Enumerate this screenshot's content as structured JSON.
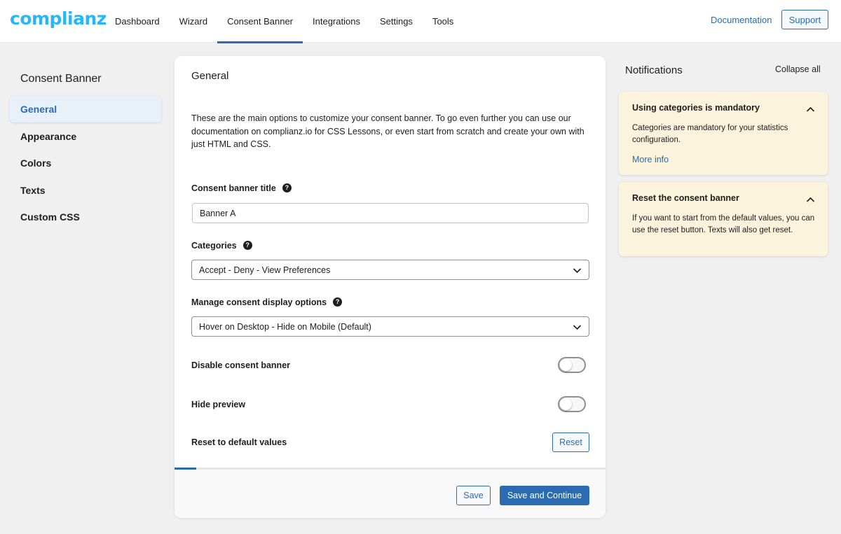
{
  "header": {
    "logo": "complianz",
    "nav": [
      {
        "label": "Dashboard"
      },
      {
        "label": "Wizard"
      },
      {
        "label": "Consent Banner",
        "active": true
      },
      {
        "label": "Integrations"
      },
      {
        "label": "Settings"
      },
      {
        "label": "Tools"
      }
    ],
    "documentation": "Documentation",
    "support": "Support"
  },
  "sidebar": {
    "title": "Consent Banner",
    "items": [
      {
        "label": "General",
        "active": true
      },
      {
        "label": "Appearance"
      },
      {
        "label": "Colors"
      },
      {
        "label": "Texts"
      },
      {
        "label": "Custom CSS"
      }
    ]
  },
  "main": {
    "title": "General",
    "intro": "These are the main options to customize your consent banner. To go even further you can use our documentation on complianz.io for CSS Lessons, or even start from scratch and create your own with just HTML and CSS.",
    "fields": {
      "banner_title": {
        "label": "Consent banner title",
        "value": "Banner A"
      },
      "categories": {
        "label": "Categories",
        "value": "Accept - Deny - View Preferences"
      },
      "manage_consent": {
        "label": "Manage consent display options",
        "value": "Hover on Desktop - Hide on Mobile (Default)"
      },
      "disable_banner": {
        "label": "Disable consent banner",
        "checked": false
      },
      "hide_preview": {
        "label": "Hide preview",
        "checked": false
      },
      "reset_defaults": {
        "label": "Reset to default values",
        "button": "Reset"
      }
    },
    "help_glyph": "?",
    "progress_percent": 5,
    "footer": {
      "save": "Save",
      "save_continue": "Save and Continue"
    }
  },
  "notifications": {
    "title": "Notifications",
    "collapse_all": "Collapse all",
    "items": [
      {
        "title": "Using categories is mandatory",
        "body": "Categories are mandatory for your statistics configuration.",
        "link": "More info"
      },
      {
        "title": "Reset the consent banner",
        "body": "If you want to start from the default values, you can use the reset button. Texts will also get reset."
      }
    ]
  },
  "colors": {
    "accent": "#2b6cb0",
    "logo": "#29b6f6",
    "notification_bg": "#fbf3dc",
    "page_bg": "#f0f0f1"
  },
  "icons": {
    "help": "question-circle-icon",
    "select_chevron": "chevron-down-icon",
    "notification_chevron": "chevron-up-icon"
  }
}
